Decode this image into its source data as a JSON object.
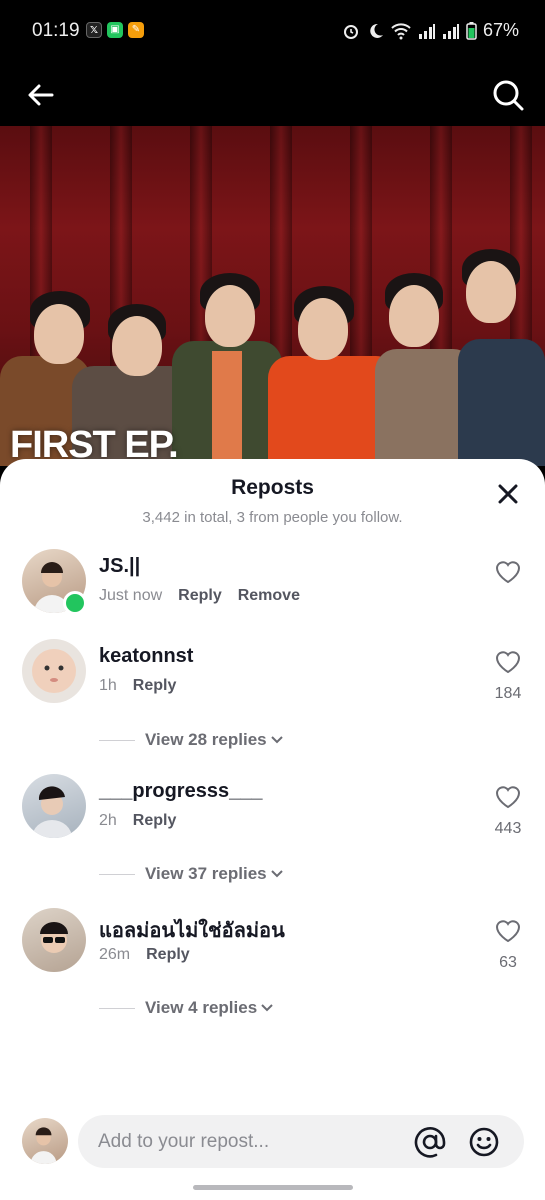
{
  "status_bar": {
    "time": "01:19",
    "battery": "67%"
  },
  "sheet": {
    "title": "Reposts",
    "subtitle": "3,442 in total, 3 from people you follow."
  },
  "overlay_text": "FIRST EP.",
  "comments": [
    {
      "name": "JS.||",
      "time": "Just now",
      "actions": [
        "Reply",
        "Remove"
      ],
      "likes": ""
    },
    {
      "name": "keatonnst",
      "time": "1h",
      "actions": [
        "Reply"
      ],
      "likes": "184",
      "view_replies": "View 28 replies"
    },
    {
      "name": "___progresss___",
      "time": "2h",
      "actions": [
        "Reply"
      ],
      "likes": "443",
      "view_replies": "View 37 replies"
    },
    {
      "name": "แอลม่อนไม่ใช่อัลม่อน",
      "time": "26m",
      "actions": [
        "Reply"
      ],
      "likes": "63",
      "view_replies": "View 4 replies"
    }
  ],
  "input": {
    "placeholder": "Add to your repost..."
  },
  "colors": {
    "online": "#22c55e",
    "text_primary": "#161823",
    "text_secondary": "#8a8b91"
  },
  "icons": [
    "back-arrow-icon",
    "search-icon",
    "close-icon",
    "heart-icon",
    "chevron-down-icon",
    "at-icon",
    "emoji-icon",
    "alarm-icon",
    "moon-icon",
    "wifi-icon",
    "signal-icon",
    "battery-icon"
  ]
}
